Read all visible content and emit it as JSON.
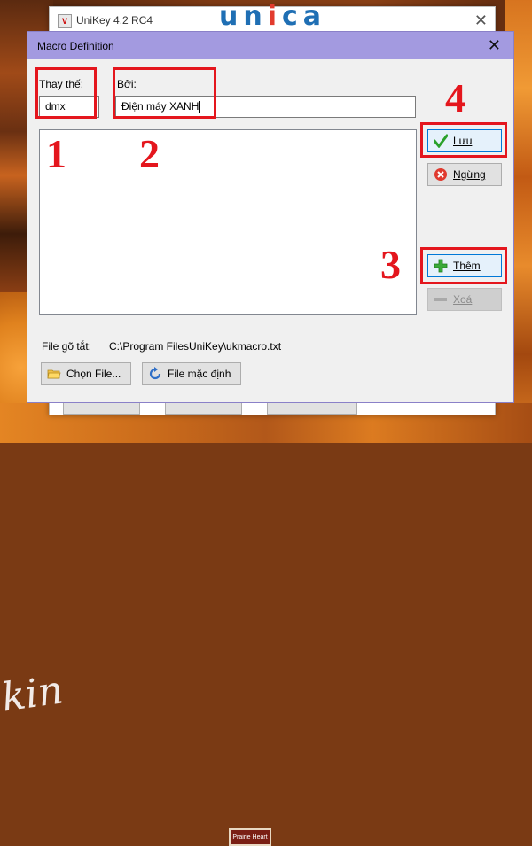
{
  "background": {
    "left_text": "kin",
    "sign_text": "Prairie Heart"
  },
  "logo": {
    "text": "unica",
    "accent_color": "#e23b2e",
    "brand_color": "#1f6fb4"
  },
  "unikey_window": {
    "title": "UniKey 4.2 RC4",
    "close_glyph": "✕",
    "icon_text": "V"
  },
  "dialog": {
    "title": "Macro Definition",
    "close_glyph": "✕",
    "replace_label": "Thay thế:",
    "replace_value": "dmx",
    "by_label": "Bởi:",
    "by_value": "Điện máy XANH",
    "file_label": "File gõ tắt:",
    "file_path": "C:\\Program FilesUniKey\\ukmacro.txt",
    "buttons": {
      "save": "Lưu",
      "stop": "Ngừng",
      "add": "Thêm",
      "delete": "Xoá",
      "choose_file": "Chọn File...",
      "default_file": "File mặc định"
    },
    "colors": {
      "titlebar": "#a39ae0",
      "callout": "#e4161d"
    }
  },
  "annotations": {
    "n1": "1",
    "n2": "2",
    "n3": "3",
    "n4": "4"
  }
}
